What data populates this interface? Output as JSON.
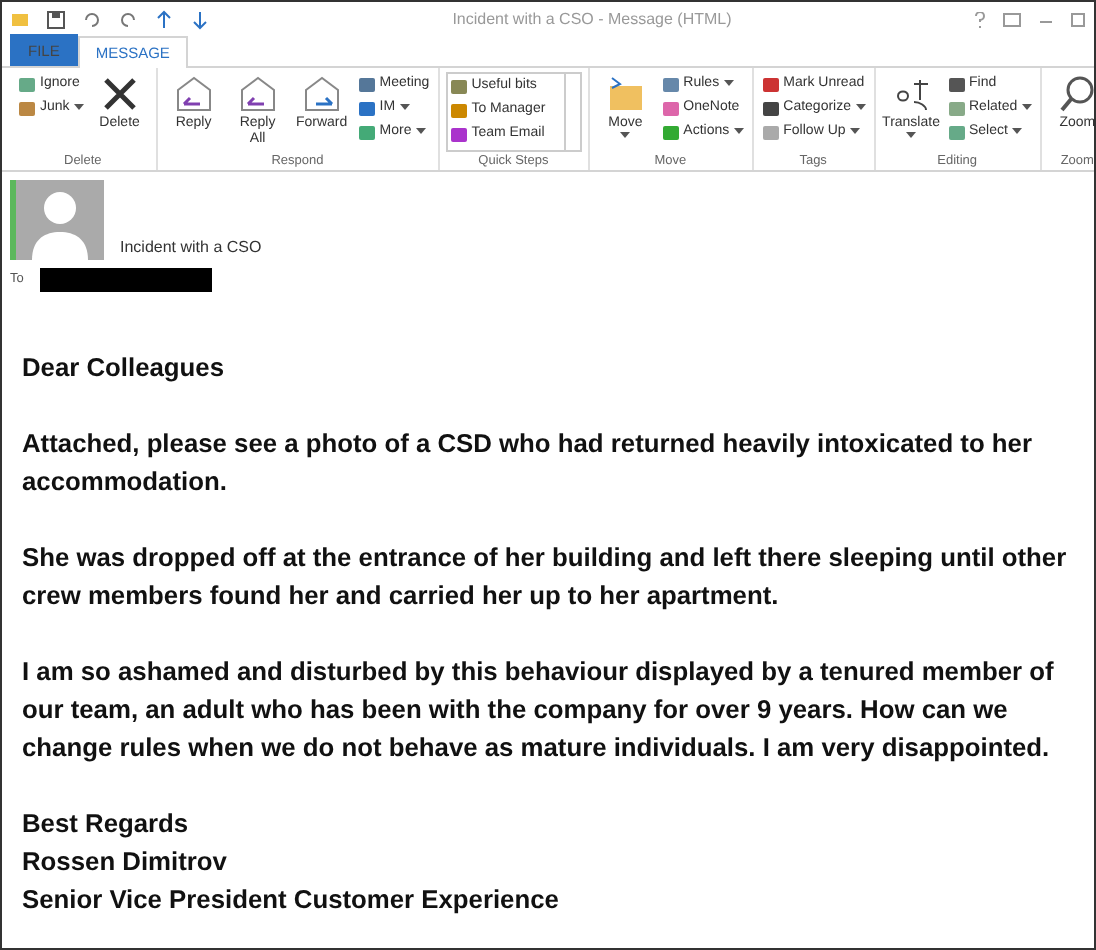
{
  "window": {
    "title": "Incident with a CSO - Message (HTML)"
  },
  "tabs": [
    {
      "label": "FILE",
      "selected": false,
      "kind": "file"
    },
    {
      "label": "MESSAGE",
      "selected": true,
      "kind": "tab"
    }
  ],
  "ribbon": [
    {
      "name": "Delete",
      "items": [
        {
          "kind": "stack",
          "items": [
            {
              "label": "Ignore",
              "caret": false
            },
            {
              "label": "Junk",
              "caret": true
            }
          ]
        },
        {
          "kind": "large",
          "label": "Delete",
          "caret": false
        }
      ]
    },
    {
      "name": "Respond",
      "items": [
        {
          "kind": "large",
          "label": "Reply",
          "caret": false
        },
        {
          "kind": "large",
          "label": "Reply All",
          "caret": false
        },
        {
          "kind": "large",
          "label": "Forward",
          "caret": false
        },
        {
          "kind": "stack",
          "items": [
            {
              "label": "Meeting",
              "caret": false
            },
            {
              "label": "IM",
              "caret": true
            },
            {
              "label": "More",
              "caret": true
            }
          ]
        }
      ]
    },
    {
      "name": "Quick Steps",
      "items": [
        {
          "kind": "gallery",
          "items": [
            {
              "label": "Useful bits",
              "caret": false
            },
            {
              "label": "To Manager",
              "caret": false
            },
            {
              "label": "Team Email",
              "caret": false
            }
          ]
        }
      ]
    },
    {
      "name": "Move",
      "items": [
        {
          "kind": "large",
          "label": "Move",
          "caret": true
        },
        {
          "kind": "stack",
          "items": [
            {
              "label": "Rules",
              "caret": true
            },
            {
              "label": "OneNote",
              "caret": false
            },
            {
              "label": "Actions",
              "caret": true
            }
          ]
        }
      ]
    },
    {
      "name": "Tags",
      "items": [
        {
          "kind": "stack",
          "items": [
            {
              "label": "Mark Unread",
              "caret": false
            },
            {
              "label": "Categorize",
              "caret": true
            },
            {
              "label": "Follow Up",
              "caret": true
            }
          ]
        }
      ]
    },
    {
      "name": "Editing",
      "items": [
        {
          "kind": "large",
          "label": "Translate",
          "caret": true
        },
        {
          "kind": "stack",
          "items": [
            {
              "label": "Find",
              "caret": false
            },
            {
              "label": "Related",
              "caret": true
            },
            {
              "label": "Select",
              "caret": true
            }
          ]
        }
      ]
    },
    {
      "name": "Zoom",
      "items": [
        {
          "kind": "large",
          "label": "Zoom",
          "caret": false
        }
      ]
    }
  ],
  "header": {
    "subject": "Incident with a CSO",
    "to_label": "To"
  },
  "body": {
    "paragraphs": [
      "Dear Colleagues",
      "Attached, please see a photo of a CSD who had returned heavily intoxicated to her accommodation.",
      "She was dropped off at the entrance of her building and left there sleeping until other crew members found her and carried her up to her apartment.",
      "I am so ashamed and disturbed by this behaviour displayed by a tenured member of our team, an adult who has been with the company for over 9 years. How can we change rules when we do not behave as mature individuals. I am very disappointed."
    ],
    "signature": [
      "Best Regards",
      "Rossen Dimitrov",
      "Senior Vice President Customer Experience"
    ]
  }
}
